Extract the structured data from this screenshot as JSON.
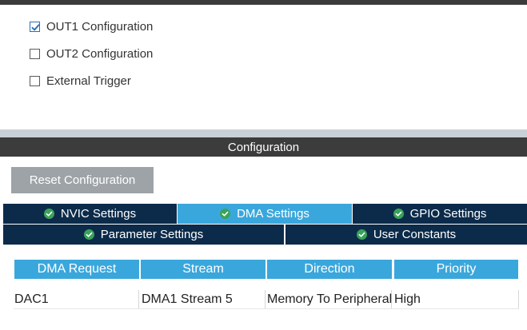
{
  "mode": {
    "options": [
      {
        "label": "OUT1 Configuration",
        "checked": true
      },
      {
        "label": "OUT2 Configuration",
        "checked": false
      },
      {
        "label": "External Trigger",
        "checked": false
      }
    ]
  },
  "configuration": {
    "title": "Configuration",
    "reset_label": "Reset Configuration",
    "tabs": [
      {
        "label": "NVIC Settings",
        "active": false
      },
      {
        "label": "DMA Settings",
        "active": true
      },
      {
        "label": "GPIO Settings",
        "active": false
      },
      {
        "label": "Parameter Settings",
        "active": false
      },
      {
        "label": "User Constants",
        "active": false
      }
    ]
  },
  "dma_table": {
    "columns": [
      "DMA Request",
      "Stream",
      "Direction",
      "Priority"
    ],
    "rows": [
      [
        "DAC1",
        "DMA1 Stream 5",
        "Memory To Peripheral",
        "High"
      ]
    ]
  },
  "colors": {
    "header_bg": "#3c3c3c",
    "tab_bg": "#0c2b4a",
    "tab_active_bg": "#3aa7dc",
    "button_bg": "#9da3a6",
    "check_green": "#3aa35a"
  }
}
